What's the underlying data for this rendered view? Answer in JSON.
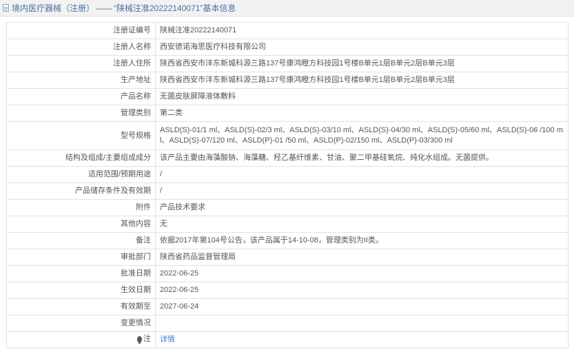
{
  "header": {
    "category": "境内医疗器械（注册）",
    "separator": "——",
    "title": "“陕械注准20222140071”基本信息"
  },
  "rows": [
    {
      "label": "注册证编号",
      "value": "陕械注准20222140071"
    },
    {
      "label": "注册人名称",
      "value": "西安德诺海思医疗科技有限公司"
    },
    {
      "label": "注册人住所",
      "value": "陕西省西安市沣东新城科源三路137号康鸿瞪方科技园1号楼B单元1层B单元2层B单元3层"
    },
    {
      "label": "生产地址",
      "value": "陕西省西安市沣东新城科源三路137号康鸿瞪方科技园1号楼B单元1层B单元2层B单元3层"
    },
    {
      "label": "产品名称",
      "value": "无菌皮肤屏障液体敷料"
    },
    {
      "label": "管理类别",
      "value": "第二类"
    },
    {
      "label": "型号规格",
      "value": "ASLD(S)-01/1 ml、ASLD(S)-02/3 ml、ASLD(S)-03/10 ml、ASLD(S)-04/30 ml、ASLD(S)-05/60 ml、ASLD(S)-06 /100 ml、ASLD(S)-07/120 ml、ASLD(P)-01 /50 ml、ASLD(P)-02/150 ml、ASLD(P)-03/300 ml"
    },
    {
      "label": "结构及组成/主要组成成分",
      "value": "该产品主要由海藻酸钠、海藻糖、羟乙基纤维素、甘油、聚二甲基硅氧烷、纯化水组成。无菌提供。"
    },
    {
      "label": "适用范围/预期用途",
      "value": "/"
    },
    {
      "label": "产品储存条件及有效期",
      "value": "/"
    },
    {
      "label": "附件",
      "value": "产品技术要求"
    },
    {
      "label": "其他内容",
      "value": "无"
    },
    {
      "label": "备注",
      "value": "依据2017年第104号公告，该产品属于14-10-08，管理类别为II类。"
    },
    {
      "label": "审批部门",
      "value": "陕西省药品监督管理局"
    },
    {
      "label": "批准日期",
      "value": "2022-06-25"
    },
    {
      "label": "生效日期",
      "value": "2022-06-25"
    },
    {
      "label": "有效期至",
      "value": "2027-06-24"
    },
    {
      "label": "变更情况",
      "value": ""
    }
  ],
  "note": {
    "label": "注",
    "link": "详情",
    "icon": "lightbulb-icon"
  }
}
